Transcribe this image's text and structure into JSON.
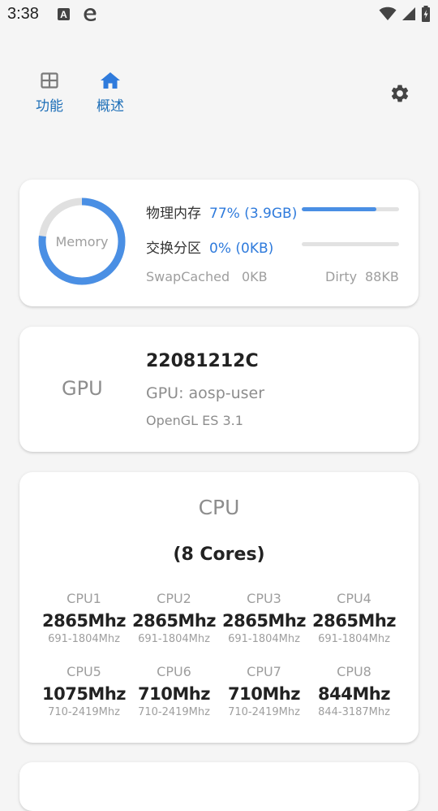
{
  "status_bar": {
    "time": "3:38",
    "icons": [
      "text-a-icon",
      "edge-browser-icon",
      "wifi-icon",
      "cell-signal-icon",
      "battery-charging-icon"
    ]
  },
  "nav": {
    "tabs": [
      {
        "label": "功能",
        "icon": "grid-icon"
      },
      {
        "label": "概述",
        "icon": "home-icon"
      }
    ],
    "settings_icon": "gear-icon",
    "accent_color": "#2f7bdc"
  },
  "memory": {
    "donut_label": "Memory",
    "donut_fraction": 0.77,
    "physical_label": "物理内存",
    "physical_value": "77% (3.9GB)",
    "physical_fraction": 0.77,
    "swap_label": "交换分区",
    "swap_value": "0% (0KB)",
    "swap_fraction": 0.0,
    "swapcached_label": "SwapCached",
    "swapcached_value": "0KB",
    "dirty_label": "Dirty",
    "dirty_value": "88KB"
  },
  "gpu": {
    "label": "GPU",
    "model": "22081212C",
    "vendor": "GPU: aosp-user",
    "opengl": "OpenGL ES 3.1"
  },
  "cpu": {
    "title": "CPU",
    "cores_label": "(8 Cores)",
    "cores": [
      {
        "name": "CPU1",
        "freq": "2865Mhz",
        "range": "691-1804Mhz"
      },
      {
        "name": "CPU2",
        "freq": "2865Mhz",
        "range": "691-1804Mhz"
      },
      {
        "name": "CPU3",
        "freq": "2865Mhz",
        "range": "691-1804Mhz"
      },
      {
        "name": "CPU4",
        "freq": "2865Mhz",
        "range": "691-1804Mhz"
      },
      {
        "name": "CPU5",
        "freq": "1075Mhz",
        "range": "710-2419Mhz"
      },
      {
        "name": "CPU6",
        "freq": "710Mhz",
        "range": "710-2419Mhz"
      },
      {
        "name": "CPU7",
        "freq": "710Mhz",
        "range": "710-2419Mhz"
      },
      {
        "name": "CPU8",
        "freq": "844Mhz",
        "range": "844-3187Mhz"
      }
    ]
  }
}
